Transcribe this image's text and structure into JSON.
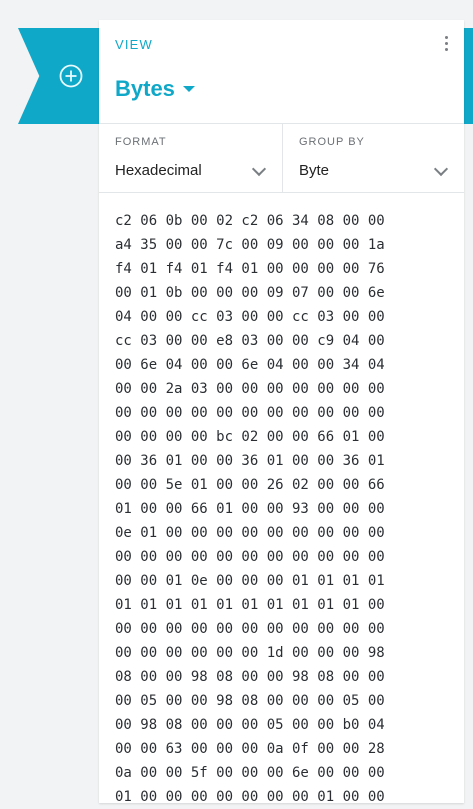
{
  "colors": {
    "accent": "#10a8c8",
    "card": "#ffffff",
    "background": "#f1f3f4"
  },
  "icons": {
    "add": "plus-circle-icon",
    "menu": "more-vert-icon",
    "dropdown": "chevron-down-icon"
  },
  "header": {
    "section_label": "VIEW",
    "view_value": "Bytes"
  },
  "controls": {
    "format": {
      "label": "FORMAT",
      "value": "Hexadecimal"
    },
    "group_by": {
      "label": "GROUP BY",
      "value": "Byte"
    }
  },
  "hex_lines": [
    "c2 06 0b 00 02 c2 06 34 08 00 00",
    "a4 35 00 00 7c 00 09 00 00 00 1a",
    "f4 01 f4 01 f4 01 00 00 00 00 76",
    "00 01 0b 00 00 00 09 07 00 00 6e",
    "04 00 00 cc 03 00 00 cc 03 00 00",
    "cc 03 00 00 e8 03 00 00 c9 04 00",
    "00 6e 04 00 00 6e 04 00 00 34 04",
    "00 00 2a 03 00 00 00 00 00 00 00",
    "00 00 00 00 00 00 00 00 00 00 00",
    "00 00 00 00 bc 02 00 00 66 01 00",
    "00 36 01 00 00 36 01 00 00 36 01",
    "00 00 5e 01 00 00 26 02 00 00 66",
    "01 00 00 66 01 00 00 93 00 00 00",
    "0e 01 00 00 00 00 00 00 00 00 00",
    "00 00 00 00 00 00 00 00 00 00 00",
    "00 00 01 0e 00 00 00 01 01 01 01",
    "01 01 01 01 01 01 01 01 01 01 00",
    "00 00 00 00 00 00 00 00 00 00 00",
    "00 00 00 00 00 00 1d 00 00 00 98",
    "08 00 00 98 08 00 00 98 08 00 00",
    "00 05 00 00 98 08 00 00 00 05 00",
    "00 98 08 00 00 00 05 00 00 b0 04",
    "00 00 63 00 00 00 0a 0f 00 00 28",
    "0a 00 00 5f 00 00 00 6e 00 00 00",
    "01 00 00 00 00 00 00 00 01 00 00"
  ]
}
